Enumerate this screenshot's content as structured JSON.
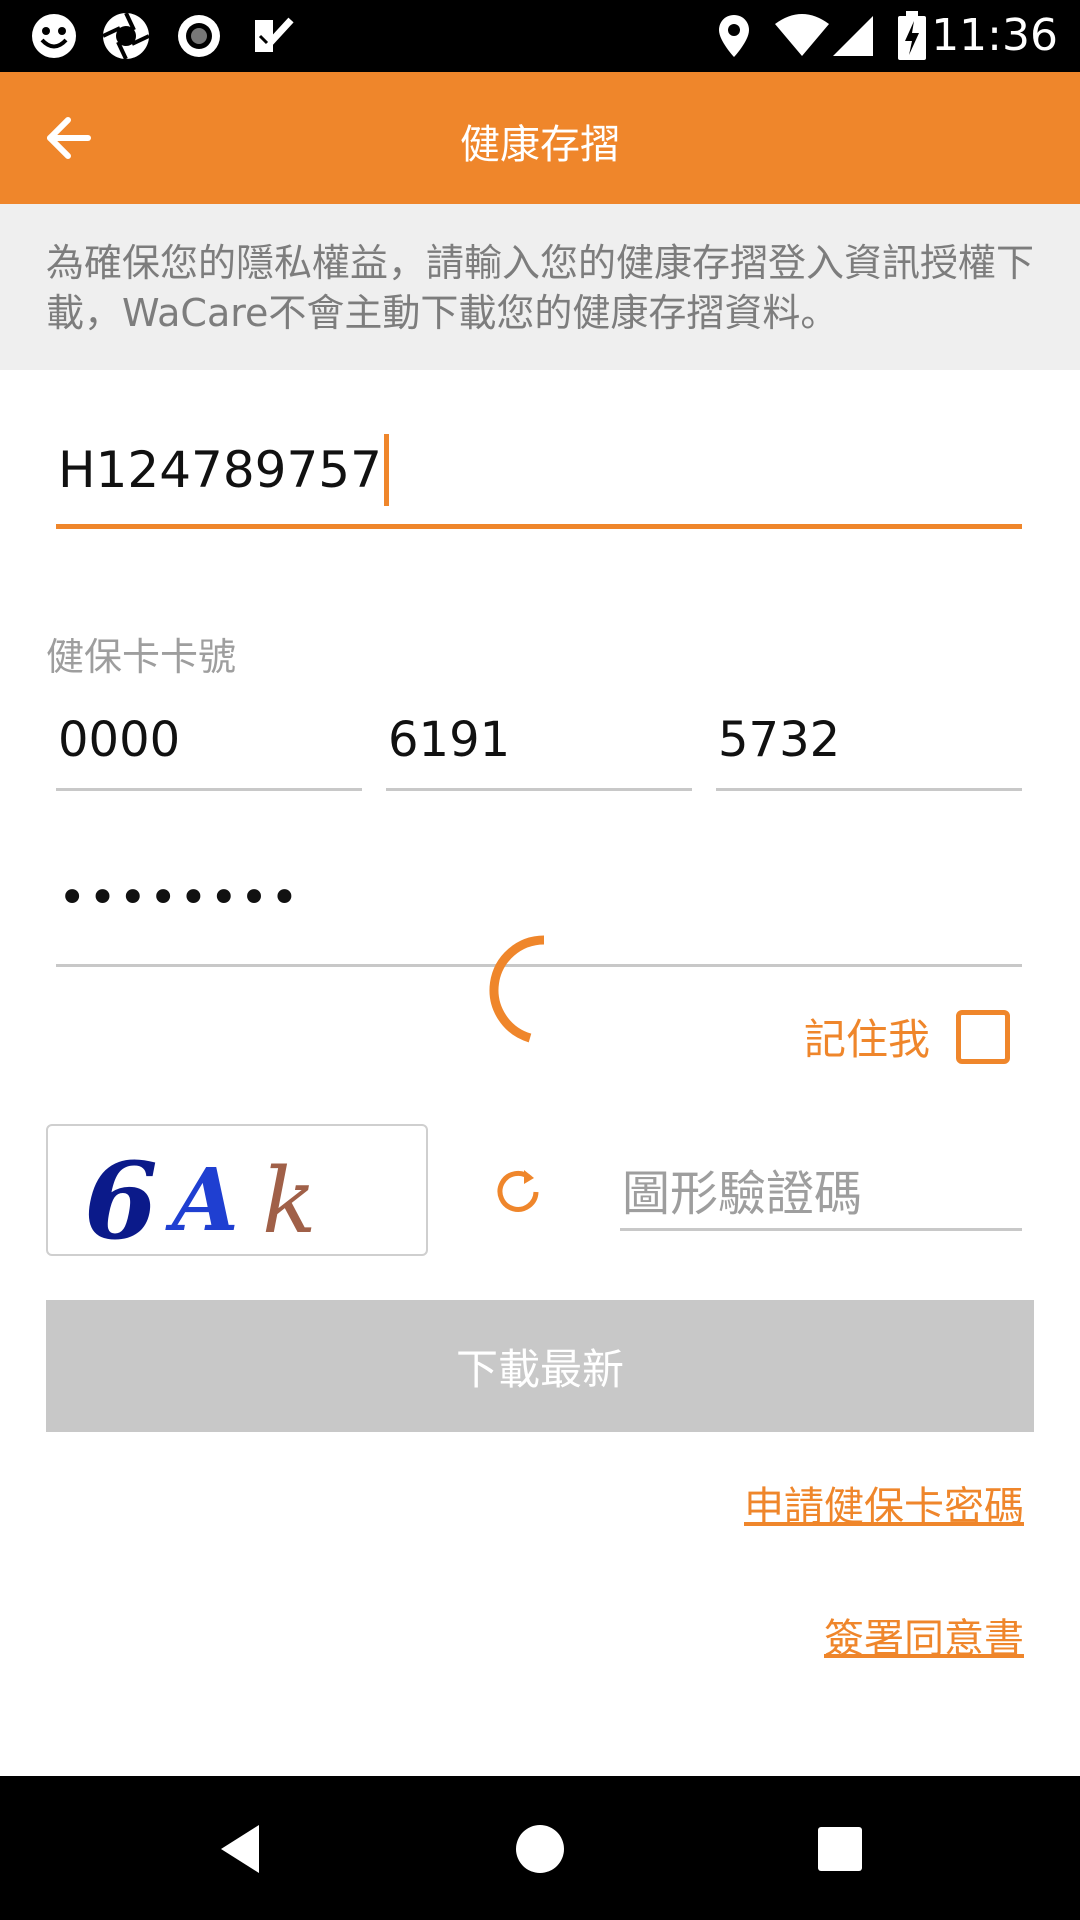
{
  "status_bar": {
    "time": "11:36",
    "left_icons": [
      "smiley-face-icon",
      "camera-shutter-icon",
      "record-icon",
      "checklist-icon"
    ],
    "right_icons": [
      "location-pin-icon",
      "wifi-icon",
      "cell-signal-icon",
      "battery-charging-icon"
    ]
  },
  "app_bar": {
    "title": "健康存摺",
    "back_icon": "arrow-left-icon",
    "background_color": "#ef862b"
  },
  "notice": {
    "text": "為確保您的隱私權益，請輸入您的健康存摺登入資訊授權下載，WaCare不會主動下載您的健康存摺資料。"
  },
  "id_field": {
    "value": "H124789757"
  },
  "health_card": {
    "label": "健保卡卡號",
    "parts": [
      "0000",
      "6191",
      "5732"
    ]
  },
  "password": {
    "value": "••••••••"
  },
  "remember_me": {
    "label": "記住我",
    "checked": false
  },
  "captcha": {
    "image_text": "6Ak",
    "refresh_icon": "refresh-icon",
    "placeholder": "圖形驗證碼"
  },
  "download_button": {
    "label": "下載最新",
    "enabled": false
  },
  "links": {
    "apply_password": "申請健保卡密碼",
    "sign_consent": "簽署同意書"
  },
  "nav_bar": {
    "icons": [
      "back-triangle-icon",
      "home-circle-icon",
      "recents-square-icon"
    ]
  },
  "colors": {
    "accent": "#ef862b",
    "disabled": "#c8c8c8",
    "notice_bg": "#efefef"
  }
}
